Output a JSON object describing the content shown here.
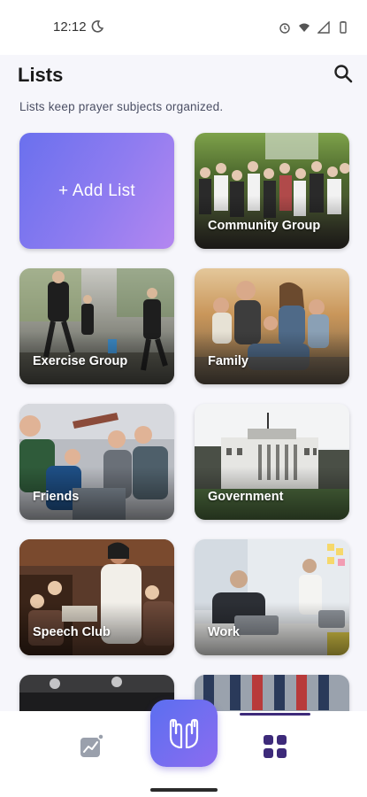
{
  "status_bar": {
    "time": "12:12"
  },
  "header": {
    "title": "Lists",
    "subtitle": "Lists keep prayer subjects organized."
  },
  "add_card": {
    "label": "+ Add List"
  },
  "lists": [
    {
      "label": "Community Group"
    },
    {
      "label": "Exercise Group"
    },
    {
      "label": "Family"
    },
    {
      "label": "Friends"
    },
    {
      "label": "Government"
    },
    {
      "label": "Speech Club"
    },
    {
      "label": "Work"
    }
  ],
  "colors": {
    "accent_start": "#5b6ff0",
    "accent_end": "#b487f0",
    "nav_active": "#3d2a7a"
  },
  "icons": {
    "status": [
      "moon-icon",
      "alarm-icon",
      "wifi-icon",
      "signal-icon",
      "battery-icon"
    ],
    "header": "search-icon",
    "nav": [
      "stats-icon",
      "praying-hands-icon",
      "grid-icon"
    ]
  }
}
